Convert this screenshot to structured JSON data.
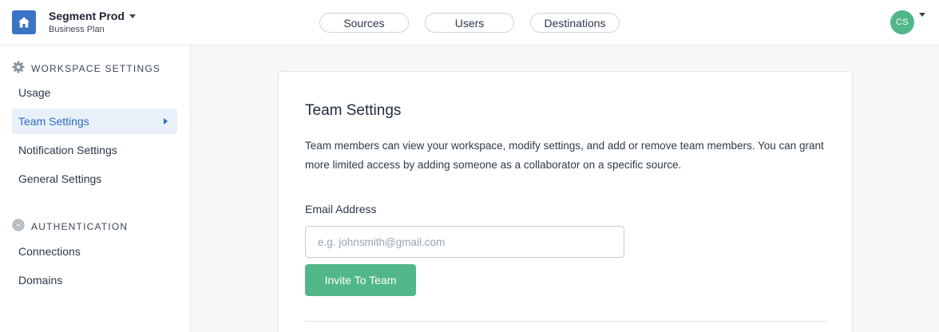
{
  "workspace": {
    "name": "Segment Prod",
    "plan": "Business Plan"
  },
  "nav_tabs": [
    {
      "label": "Sources"
    },
    {
      "label": "Users"
    },
    {
      "label": "Destinations"
    }
  ],
  "user": {
    "initials": "CS",
    "avatar_color": "#52b788"
  },
  "sidebar": {
    "workspace_section": {
      "title": "WORKSPACE SETTINGS",
      "icon": "gear-icon",
      "items": [
        {
          "label": "Usage"
        },
        {
          "label": "Team Settings",
          "active": true
        },
        {
          "label": "Notification Settings"
        },
        {
          "label": "General Settings"
        }
      ]
    },
    "auth_section": {
      "title": "AUTHENTICATION",
      "icon": "fingerprint-icon",
      "items": [
        {
          "label": "Connections"
        },
        {
          "label": "Domains"
        }
      ]
    }
  },
  "main": {
    "title": "Team Settings",
    "description": "Team members can view your workspace, modify settings, and add or remove team members. You can grant more limited access by adding someone as a collaborator on a specific source.",
    "email_label": "Email Address",
    "email_value": "",
    "email_placeholder": "e.g. johnsmith@gmail.com",
    "invite_button": "Invite To Team"
  },
  "colors": {
    "brand": "#3b74c5",
    "accent": "#52b788",
    "active_nav": "#2f6cc0"
  }
}
